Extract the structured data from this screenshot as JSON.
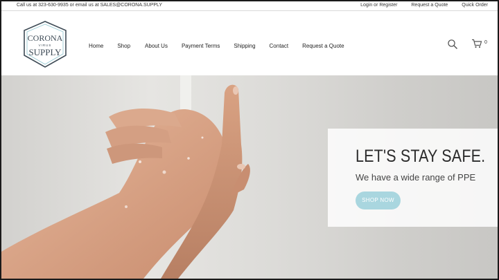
{
  "topbar": {
    "contact": "Call us at 323-630-9935 or email us at SALES@CORONA.SUPPLY",
    "login": "Login or Register",
    "request_quote": "Request a Quote",
    "quick_order": "Quick Order"
  },
  "logo": {
    "line1": "CORONA",
    "line2": "VIRUS",
    "line3": "SUPPLY"
  },
  "nav": {
    "items": [
      "Home",
      "Shop",
      "About Us",
      "Payment Terms",
      "Shipping",
      "Contact",
      "Request a Quote"
    ]
  },
  "cart": {
    "count": "0"
  },
  "hero": {
    "headline": "LET'S STAY SAFE.",
    "subline": "We have a wide range of PPE",
    "button": "SHOP NOW",
    "button_color": "#a9d6df"
  },
  "icons": [
    "search-icon",
    "cart-icon"
  ]
}
